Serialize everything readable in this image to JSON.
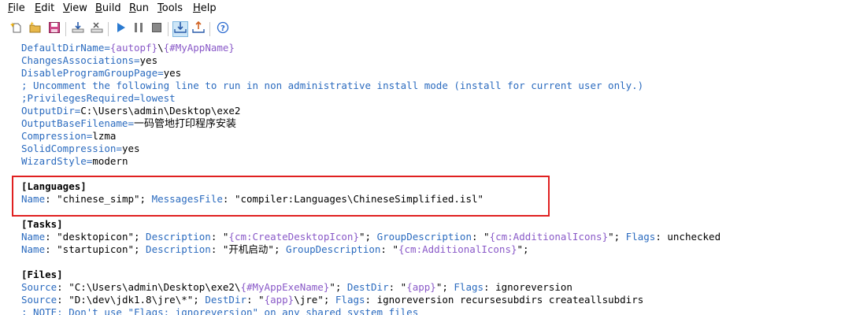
{
  "menu": {
    "file": {
      "u": "F",
      "rest": "ile"
    },
    "edit": {
      "u": "E",
      "rest": "dit"
    },
    "view": {
      "u": "V",
      "rest": "iew"
    },
    "build": {
      "u": "B",
      "rest": "uild"
    },
    "run": {
      "u": "R",
      "rest": "un"
    },
    "tools": {
      "u": "T",
      "rest": "ools"
    },
    "help": {
      "u": "H",
      "rest": "elp"
    }
  },
  "editor": {
    "l1": {
      "key": "DefaultDirName=",
      "c1": "{autopf}",
      "t": "\\",
      "c2": "{#MyAppName}"
    },
    "l2": {
      "key": "ChangesAssociations=",
      "val": "yes"
    },
    "l3": {
      "key": "DisableProgramGroupPage=",
      "val": "yes"
    },
    "l4": {
      "comment": "; Uncomment the following line to run in non administrative install mode (install for current user only.)"
    },
    "l5": {
      "comment": ";PrivilegesRequired=lowest"
    },
    "l6": {
      "key": "OutputDir=",
      "val": "C:\\Users\\admin\\Desktop\\exe2"
    },
    "l7": {
      "key": "OutputBaseFilename=",
      "val": "一码管地打印程序安装"
    },
    "l8": {
      "key": "Compression=",
      "val": "lzma"
    },
    "l9": {
      "key": "SolidCompression=",
      "val": "yes"
    },
    "l10": {
      "key": "WizardStyle=",
      "val": "modern"
    },
    "languages_header": "[Languages]",
    "lang1": {
      "k1": "Name",
      "v1": ": \"chinese_simp\"; ",
      "k2": "MessagesFile",
      "v2": ": \"compiler:Languages\\ChineseSimplified.isl\""
    },
    "tasks_header": "[Tasks]",
    "task1": {
      "k1": "Name",
      "v1": ": \"desktopicon\"; ",
      "k2": "Description",
      "v2a": ": \"",
      "c1": "{cm:CreateDesktopIcon}",
      "v2b": "\"; ",
      "k3": "GroupDescription",
      "v3a": ": \"",
      "c2": "{cm:AdditionalIcons}",
      "v3b": "\"; ",
      "k4": "Flags",
      "v4": ": unchecked"
    },
    "task2": {
      "k1": "Name",
      "v1": ": \"startupicon\"; ",
      "k2": "Description",
      "v2": ": \"开机启动\"; ",
      "k3": "GroupDescription",
      "v3a": ": \"",
      "c1": "{cm:AdditionalIcons}",
      "v3b": "\";"
    },
    "files_header": "[Files]",
    "file1": {
      "k1": "Source",
      "v1a": ": \"C:\\Users\\admin\\Desktop\\exe2\\",
      "c1": "{#MyAppExeName}",
      "v1b": "\"; ",
      "k2": "DestDir",
      "v2a": ": \"",
      "c2": "{app}",
      "v2b": "\"; ",
      "k3": "Flags",
      "v3": ": ignoreversion"
    },
    "file2": {
      "k1": "Source",
      "v1": ": \"D:\\dev\\jdk1.8\\jre\\*\"; ",
      "k2": "DestDir",
      "v2a": ": \"",
      "c1": "{app}",
      "v2b": "\\jre\"; ",
      "k3": "Flags",
      "v3": ": ignoreversion recursesubdirs createallsubdirs"
    },
    "l_note": {
      "comment": "; NOTE: Don't use \"Flags: ignoreversion\" on any shared system files"
    }
  },
  "colors": {
    "keyword": "#2b6bbf",
    "constant": "#8a5ac8",
    "highlight_box": "#e02020"
  },
  "toolbar_icons": [
    "new-file-icon",
    "new-wizard-icon",
    "save-icon",
    "compile-icon",
    "stop-compile-icon",
    "run-icon",
    "pause-icon",
    "terminate-icon",
    "target-down-icon",
    "target-up-icon",
    "help-icon"
  ]
}
